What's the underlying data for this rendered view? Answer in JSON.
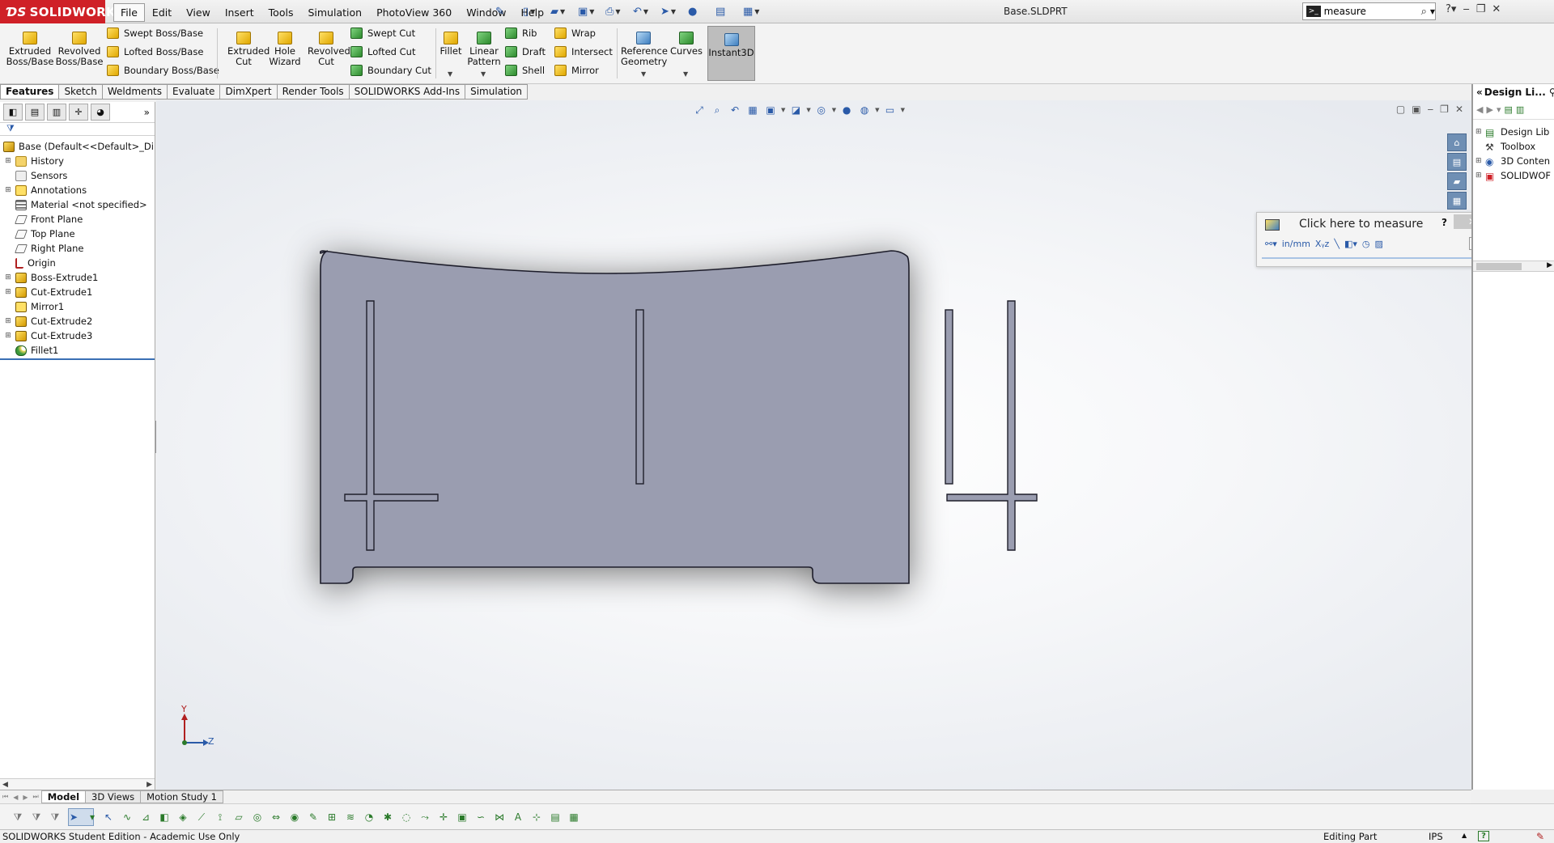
{
  "app": {
    "brand": "SOLIDWORKS",
    "document_title": "Base.SLDPRT"
  },
  "menu": [
    "File",
    "Edit",
    "View",
    "Insert",
    "Tools",
    "Simulation",
    "PhotoView 360",
    "Window",
    "Help"
  ],
  "search": {
    "value": "measure"
  },
  "command_manager": {
    "extruded_boss": "Extruded Boss/Base",
    "revolved_boss": "Revolved Boss/Base",
    "swept_boss": "Swept Boss/Base",
    "lofted_boss": "Lofted Boss/Base",
    "boundary_boss": "Boundary Boss/Base",
    "extruded_cut": "Extruded Cut",
    "hole_wizard": "Hole Wizard",
    "revolved_cut": "Revolved Cut",
    "swept_cut": "Swept Cut",
    "lofted_cut": "Lofted Cut",
    "boundary_cut": "Boundary Cut",
    "fillet": "Fillet",
    "linear_pattern": "Linear Pattern",
    "rib": "Rib",
    "wrap": "Wrap",
    "draft": "Draft",
    "intersect": "Intersect",
    "shell": "Shell",
    "mirror": "Mirror",
    "reference_geometry": "Reference Geometry",
    "curves": "Curves",
    "instant3d": "Instant3D"
  },
  "tabs": [
    "Features",
    "Sketch",
    "Weldments",
    "Evaluate",
    "DimXpert",
    "Render Tools",
    "SOLIDWORKS Add-Ins",
    "Simulation"
  ],
  "feature_tree": {
    "root": "Base  (Default<<Default>_Di",
    "items": [
      {
        "label": "History",
        "expandable": true,
        "icon": "folder-icon"
      },
      {
        "label": "Sensors",
        "expandable": false,
        "icon": "sensor-icon"
      },
      {
        "label": "Annotations",
        "expandable": true,
        "icon": "annotations-icon"
      },
      {
        "label": "Material <not specified>",
        "expandable": false,
        "icon": "material-icon"
      },
      {
        "label": "Front Plane",
        "expandable": false,
        "icon": "plane-icon"
      },
      {
        "label": "Top Plane",
        "expandable": false,
        "icon": "plane-icon"
      },
      {
        "label": "Right Plane",
        "expandable": false,
        "icon": "plane-icon"
      },
      {
        "label": "Origin",
        "expandable": false,
        "icon": "origin-icon"
      },
      {
        "label": "Boss-Extrude1",
        "expandable": true,
        "icon": "extrude-icon"
      },
      {
        "label": "Cut-Extrude1",
        "expandable": true,
        "icon": "cut-extrude-icon"
      },
      {
        "label": "Mirror1",
        "expandable": false,
        "icon": "mirror-icon"
      },
      {
        "label": "Cut-Extrude2",
        "expandable": true,
        "icon": "cut-extrude-icon"
      },
      {
        "label": "Cut-Extrude3",
        "expandable": true,
        "icon": "cut-extrude-icon"
      },
      {
        "label": "Fillet1",
        "expandable": false,
        "icon": "fillet-icon"
      }
    ]
  },
  "measure_popup": {
    "title": "Click here to measure",
    "help": "?"
  },
  "task_pane": {
    "title": "Design Li...",
    "items": [
      {
        "label": "Design Lib",
        "icon": "design-library-icon"
      },
      {
        "label": "Toolbox",
        "icon": "toolbox-icon"
      },
      {
        "label": "3D Conten",
        "icon": "3d-content-icon"
      },
      {
        "label": "SOLIDWOF",
        "icon": "solidworks-content-icon"
      }
    ]
  },
  "triad": {
    "y": "Y",
    "z": "Z"
  },
  "bottom_tabs": [
    "Model",
    "3D Views",
    "Motion Study 1"
  ],
  "status": {
    "left": "SOLIDWORKS Student Edition - Academic Use Only",
    "mode": "Editing Part",
    "units": "IPS"
  },
  "colors": {
    "brand_red": "#cf2027",
    "part_face": "#9a9db0",
    "part_edge": "#1e1e2a"
  }
}
